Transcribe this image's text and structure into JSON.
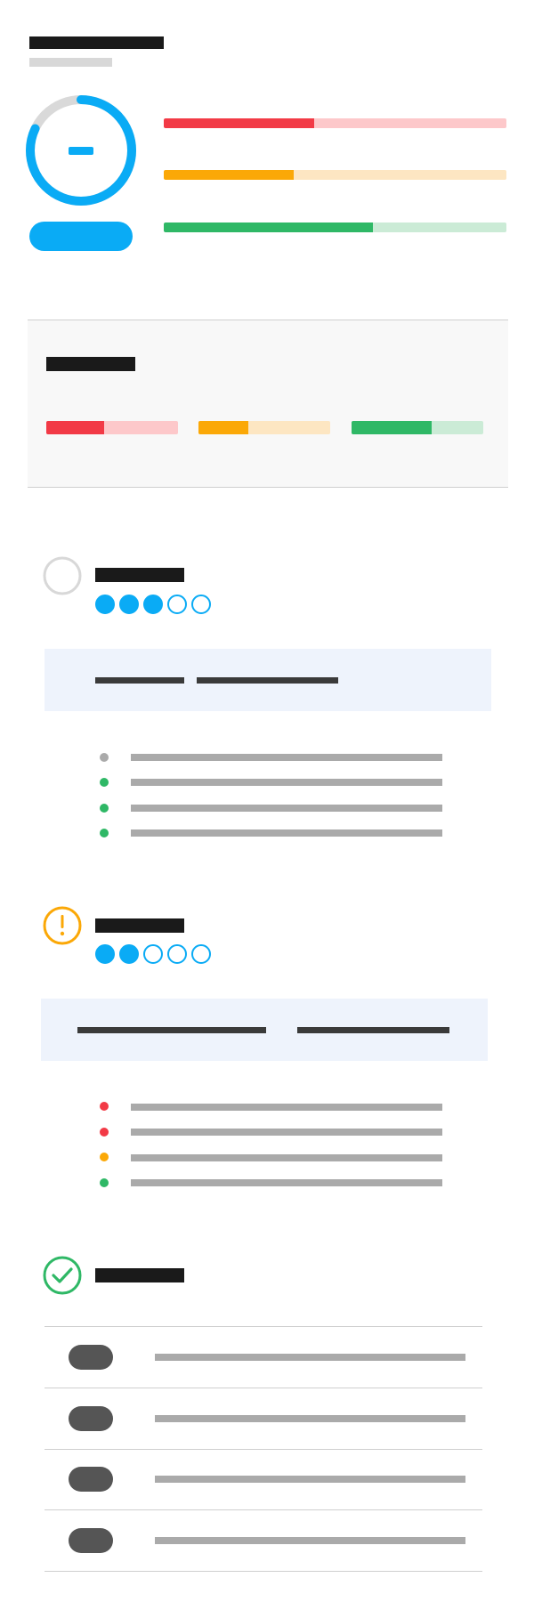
{
  "header": {
    "title": "",
    "subtitle": "",
    "score_progress": 0.82,
    "accent_color": "#0aabf5",
    "action_label": ""
  },
  "meters": [
    {
      "label": "",
      "level": 0.44,
      "color": "#f23a46",
      "track_color": "#fdc8ca"
    },
    {
      "label": "",
      "level": 0.38,
      "color": "#fba807",
      "track_color": "#fde6c2"
    },
    {
      "label": "",
      "level": 0.61,
      "color": "#2fb866",
      "track_color": "#cbebd6"
    }
  ],
  "summary": {
    "title": "",
    "meters": [
      {
        "level": 0.44,
        "color": "#f23a46",
        "track_color": "#fdc8ca"
      },
      {
        "level": 0.38,
        "color": "#fba807",
        "track_color": "#fde6c2"
      },
      {
        "level": 0.61,
        "color": "#2fb866",
        "track_color": "#cbebd6"
      }
    ]
  },
  "items": [
    {
      "title": "",
      "status_icon": "empty-circle-icon",
      "status_color": "#d8d8d8",
      "rating": 3,
      "rating_max": 5,
      "info": {
        "left": "",
        "right": ""
      },
      "bullets": [
        {
          "text": "",
          "color": "#aaaaaa"
        },
        {
          "text": "",
          "color": "#2fb866"
        },
        {
          "text": "",
          "color": "#2fb866"
        },
        {
          "text": "",
          "color": "#2fb866"
        }
      ]
    },
    {
      "title": "",
      "status_icon": "warning-icon",
      "status_color": "#fba807",
      "rating": 2,
      "rating_max": 5,
      "info": {
        "left": "",
        "right": ""
      },
      "bullets": [
        {
          "text": "",
          "color": "#f23a46"
        },
        {
          "text": "",
          "color": "#f23a46"
        },
        {
          "text": "",
          "color": "#fba807"
        },
        {
          "text": "",
          "color": "#2fb866"
        }
      ]
    },
    {
      "title": "",
      "status_icon": "check-circle-icon",
      "status_color": "#2fb866",
      "rows": [
        {
          "button": "",
          "text": ""
        },
        {
          "button": "",
          "text": ""
        },
        {
          "button": "",
          "text": ""
        },
        {
          "button": "",
          "text": ""
        }
      ]
    }
  ]
}
